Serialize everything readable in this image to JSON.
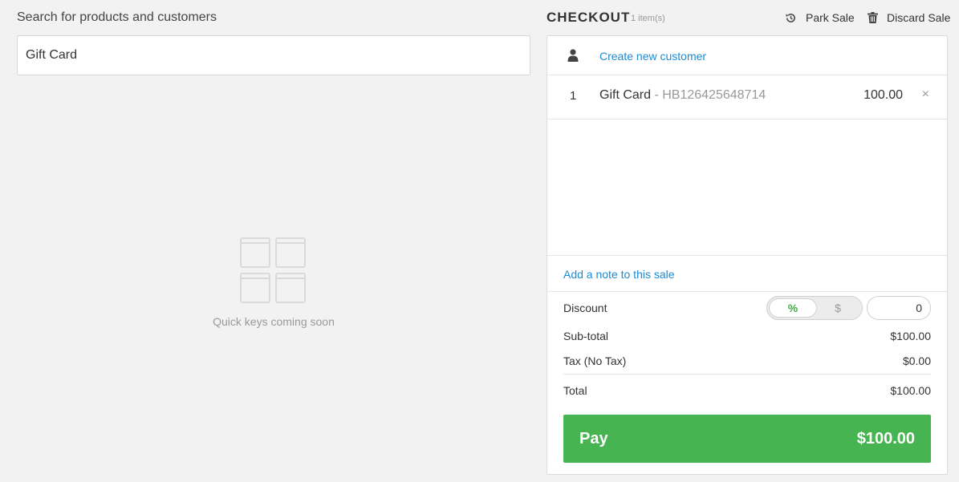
{
  "search": {
    "label": "Search for products and customers",
    "value": "Gift Card"
  },
  "quick_keys": {
    "message": "Quick keys coming soon",
    "icon": "quick-keys-grid-icon"
  },
  "checkout": {
    "title": "CHECKOUT",
    "item_count": "1 item(s)",
    "actions": {
      "park_sale": "Park Sale",
      "discard_sale": "Discard Sale"
    },
    "customer": {
      "link": "Create new customer"
    },
    "line_items": [
      {
        "qty": "1",
        "name": "Gift Card",
        "sku": " - HB126425648714",
        "price": "100.00",
        "remove": "×"
      }
    ],
    "note_link": "Add a note to this sale",
    "discount": {
      "label": "Discount",
      "percent_option": "%",
      "dollar_option": "$",
      "value": "0"
    },
    "subtotal": {
      "label": "Sub-total",
      "value": "$100.00"
    },
    "tax": {
      "label": "Tax (No Tax)",
      "value": "$0.00"
    },
    "total": {
      "label": "Total",
      "value": "$100.00"
    },
    "pay": {
      "label": "Pay",
      "amount": "$100.00"
    }
  },
  "colors": {
    "accent_green": "#46b450",
    "link_blue": "#1b8bd6",
    "background": "#f2f2f2"
  }
}
